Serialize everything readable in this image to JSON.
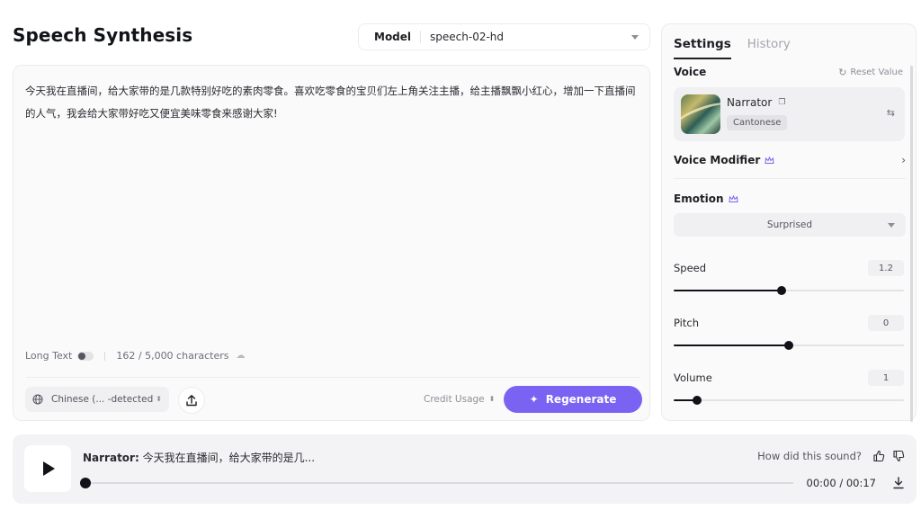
{
  "page": {
    "title": "Speech Synthesis"
  },
  "model": {
    "label": "Model",
    "value": "speech-02-hd"
  },
  "editor": {
    "text": "今天我在直播间，给大家带的是几款特别好吃的素肉零食。喜欢吃零食的宝贝们左上角关注主播，给主播飘飘小红心，增加一下直播间的人气，我会给大家带好吃又便宜美味零食来感谢大家!",
    "long_text_label": "Long Text",
    "long_text_on": false,
    "char_count": "162 / 5,000 characters",
    "language": "Chinese (... -detected",
    "credit_label": "Credit Usage",
    "regenerate_label": "Regenerate"
  },
  "panel": {
    "tabs": [
      {
        "label": "Settings",
        "active": true
      },
      {
        "label": "History",
        "active": false
      }
    ],
    "voice": {
      "title": "Voice",
      "reset_label": "Reset Value",
      "name": "Narrator",
      "tag": "Cantonese"
    },
    "voice_modifier": {
      "title": "Voice Modifier"
    },
    "emotion": {
      "title": "Emotion",
      "value": "Surprised"
    },
    "speed": {
      "label": "Speed",
      "value": "1.2",
      "fraction": 0.47
    },
    "pitch": {
      "label": "Pitch",
      "value": "0",
      "fraction": 0.5
    },
    "volume": {
      "label": "Volume",
      "value": "1",
      "fraction": 0.1
    }
  },
  "player": {
    "narrator_label": "Narrator:",
    "snippet": "今天我在直播间，给大家带的是几...",
    "feedback_label": "How did this sound?",
    "time": "00:00 / 00:17",
    "progress": 0
  },
  "colors": {
    "accent": "#7a63f2",
    "slider": "#111318"
  },
  "icons": [
    "globe-icon",
    "upload-icon",
    "sparkle-icon",
    "reset-icon",
    "copy-icon",
    "swap-icon",
    "crown-icon",
    "chevron-right-icon",
    "play-icon",
    "thumbs-up-icon",
    "thumbs-down-icon",
    "download-icon"
  ]
}
